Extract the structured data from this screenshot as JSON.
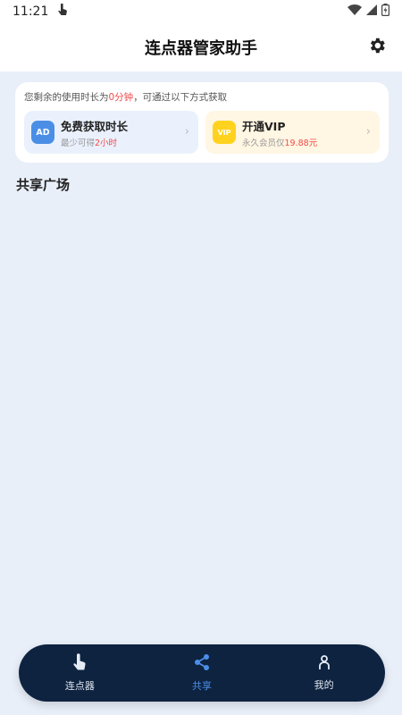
{
  "status": {
    "time": "11:21"
  },
  "appbar": {
    "title": "连点器管家助手",
    "settings_icon": "gear-icon"
  },
  "card": {
    "msg_prefix": "您剩余的使用时长为",
    "msg_highlight": "0分钟",
    "msg_suffix": "，可通过以下方式获取",
    "ad": {
      "icon_text": "AD",
      "title": "免费获取时长",
      "sub_prefix": "最少可得",
      "sub_highlight": "2小时"
    },
    "vip": {
      "icon_text": "VIP",
      "title": "开通VIP",
      "sub_prefix": "永久会员仅",
      "sub_highlight": "19.88元"
    }
  },
  "section": {
    "title": "共享广场"
  },
  "nav": {
    "items": [
      {
        "label": "连点器",
        "icon": "tap-icon",
        "active": false
      },
      {
        "label": "共享",
        "icon": "share-icon",
        "active": true
      },
      {
        "label": "我的",
        "icon": "person-icon",
        "active": false
      }
    ]
  },
  "colors": {
    "accent": "#4b8ee6",
    "highlight": "#f04a4a",
    "nav_bg": "#0e2340",
    "page_bg": "#e9eff9"
  }
}
